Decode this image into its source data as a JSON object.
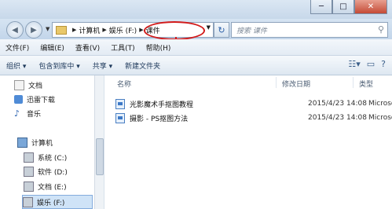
{
  "window": {
    "controls": {
      "minimize": "─",
      "maximize": "□",
      "close": "✕"
    }
  },
  "address": {
    "breadcrumbs": [
      "计算机",
      "娱乐 (F:)",
      "课件"
    ],
    "search_placeholder": "搜索 课件"
  },
  "menu": [
    "文件(F)",
    "编辑(E)",
    "查看(V)",
    "工具(T)",
    "帮助(H)"
  ],
  "toolbar": [
    "组织 ▾",
    "包含到库中 ▾",
    "共享 ▾",
    "新建文件夹"
  ],
  "sidebar": {
    "items": [
      {
        "label": "文档",
        "icon": "document-icon"
      },
      {
        "label": "迅雷下载",
        "icon": "download-icon"
      },
      {
        "label": "音乐",
        "icon": "music-icon"
      },
      {
        "label": "计算机",
        "icon": "computer-icon"
      },
      {
        "label": "系统 (C:)",
        "icon": "drive-icon"
      },
      {
        "label": "软件 (D:)",
        "icon": "drive-icon"
      },
      {
        "label": "文档 (E:)",
        "icon": "drive-icon"
      },
      {
        "label": "娱乐 (F:)",
        "icon": "drive-icon"
      }
    ]
  },
  "files": {
    "columns": [
      "名称",
      "修改日期",
      "类型"
    ],
    "rows": [
      {
        "name": "光影魔术手抠图教程",
        "date": "2015/4/23 14:08",
        "type": "Microso"
      },
      {
        "name": "摄影 - PS抠图方法",
        "date": "2015/4/23 14:08",
        "type": "Microso"
      }
    ]
  },
  "colors": {
    "annotation": "#d21a1a",
    "selection": "#cfe3f7"
  }
}
